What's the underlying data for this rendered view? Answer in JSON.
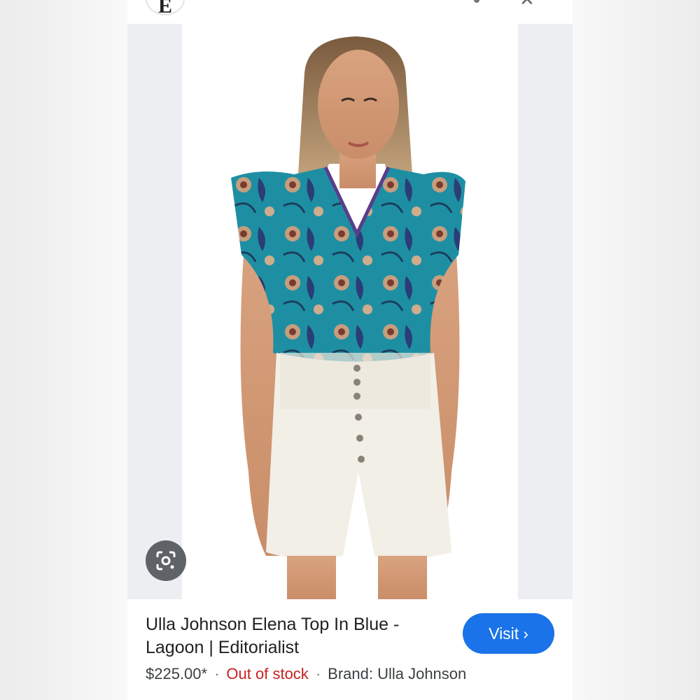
{
  "header": {
    "site_logo_letter": "E"
  },
  "product": {
    "title": "Ulla Johnson Elena Top In Blue - Lagoon | Editorialist",
    "price": "$225.00*",
    "stock_status": "Out of stock",
    "brand": "Brand: Ulla Johnson",
    "separator": "·"
  },
  "actions": {
    "visit_label": "Visit",
    "visit_chevron": "›"
  },
  "icons": {
    "lens": "google-lens-icon"
  },
  "colors": {
    "accent": "#1a73e8",
    "out_of_stock": "#c5221f",
    "top": "#1e8fa3"
  }
}
